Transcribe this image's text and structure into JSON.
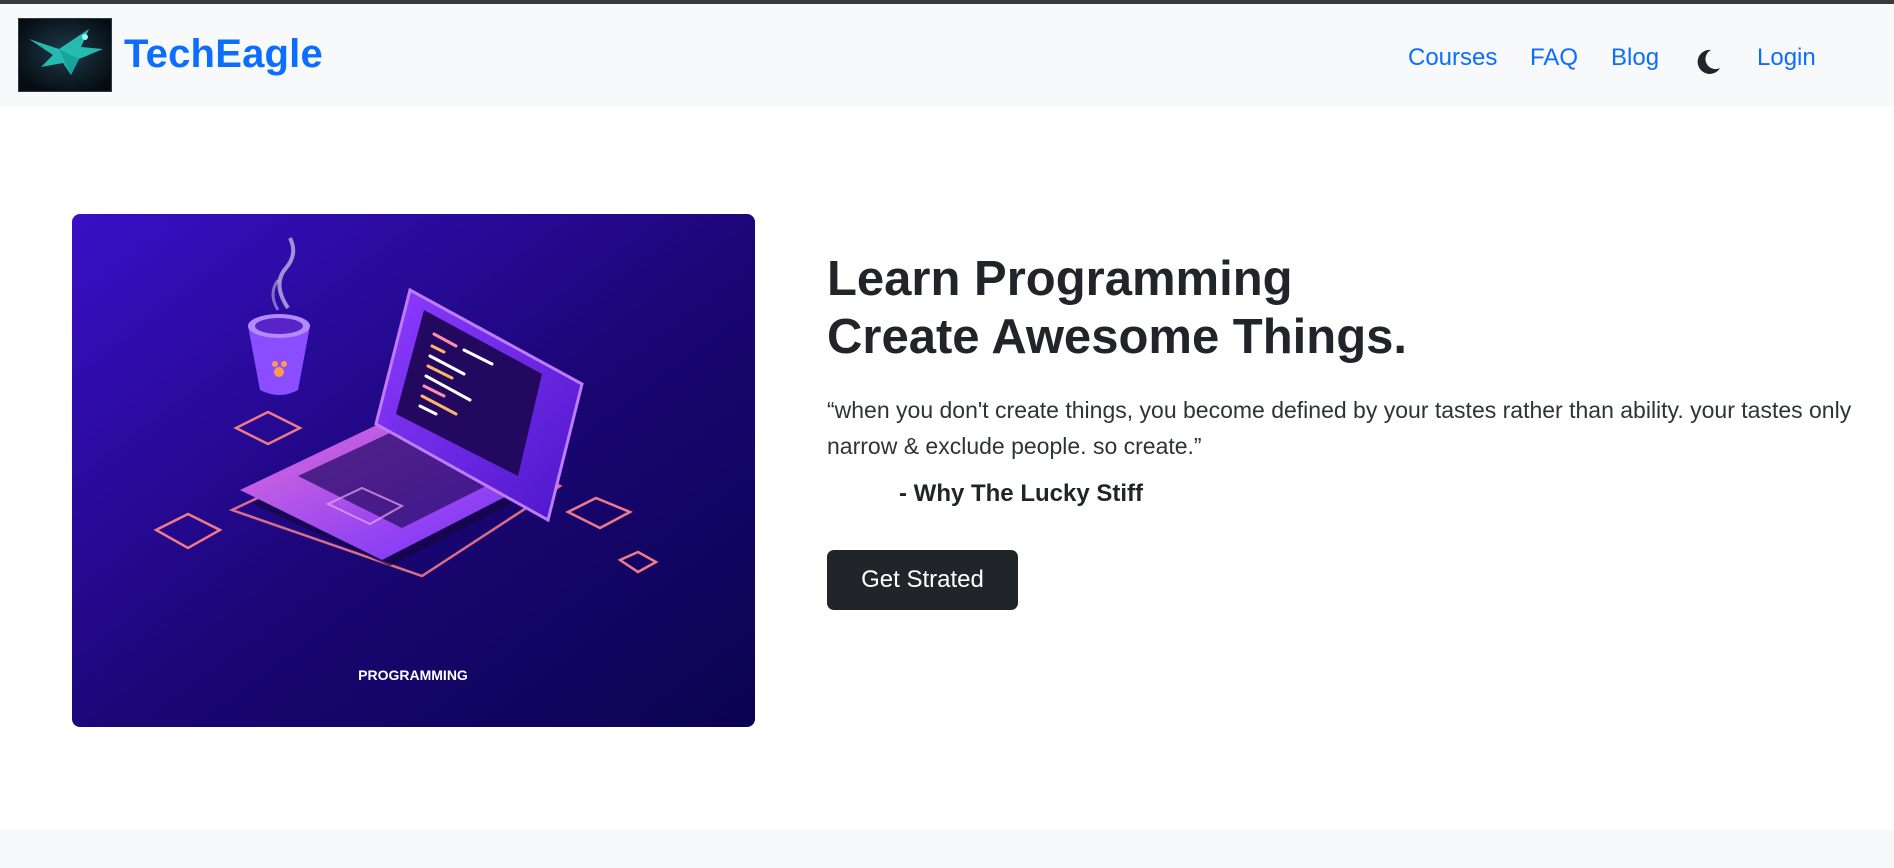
{
  "header": {
    "brand": "TechEagle",
    "nav": {
      "courses": "Courses",
      "faq": "FAQ",
      "blog": "Blog",
      "login": "Login"
    }
  },
  "hero": {
    "image_caption": "PROGRAMMING",
    "headline_line1": "Learn Programming",
    "headline_line2": "Create Awesome Things.",
    "quote": "“when you don't create things, you become defined by your tastes rather than ability. your tastes only narrow & exclude people. so create.”",
    "author": "- Why The Lucky Stiff",
    "cta_label": "Get Strated"
  },
  "colors": {
    "brand_blue": "#0d6efd",
    "dark_button": "#212529",
    "navbar_bg": "#f8f9fa"
  },
  "icons": {
    "theme_toggle": "moon-icon",
    "logo": "eagle-logo"
  }
}
